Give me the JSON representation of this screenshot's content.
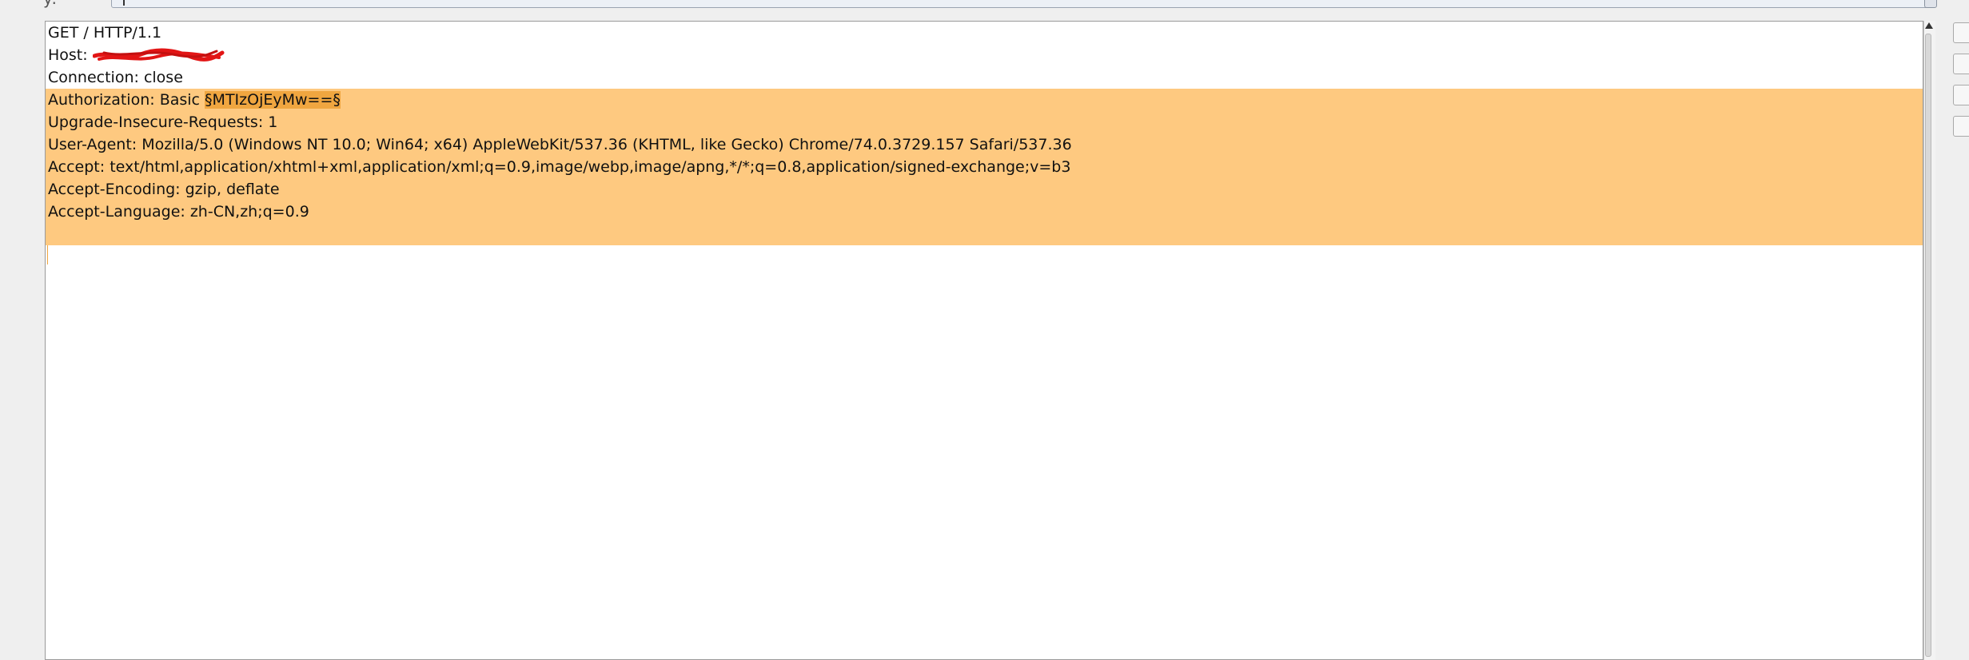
{
  "top_bar": {
    "label": "y:",
    "field_value": "|"
  },
  "request": {
    "request_line": "GET / HTTP/1.1",
    "host_prefix": "Host: ",
    "host_redacted": "redacted",
    "connection": "Connection: close",
    "authorization_prefix": "Authorization: Basic ",
    "authorization_payload": "§MTIzOjEyMw==§",
    "upgrade_insecure": "Upgrade-Insecure-Requests: 1",
    "user_agent": "User-Agent: Mozilla/5.0 (Windows NT 10.0; Win64; x64) AppleWebKit/537.36 (KHTML, like Gecko) Chrome/74.0.3729.157 Safari/537.36",
    "accept": "Accept: text/html,application/xhtml+xml,application/xml;q=0.9,image/webp,image/apng,*/*;q=0.8,application/signed-exchange;v=b3",
    "accept_encoding": "Accept-Encoding: gzip, deflate",
    "accept_language": "Accept-Language: zh-CN,zh;q=0.9"
  },
  "colors": {
    "highlight": "#fec980",
    "payload_marker": "#f0a640",
    "redaction": "#e21515"
  },
  "side_buttons": [
    "add-marker",
    "clear-markers",
    "auto-marker",
    "refresh"
  ]
}
